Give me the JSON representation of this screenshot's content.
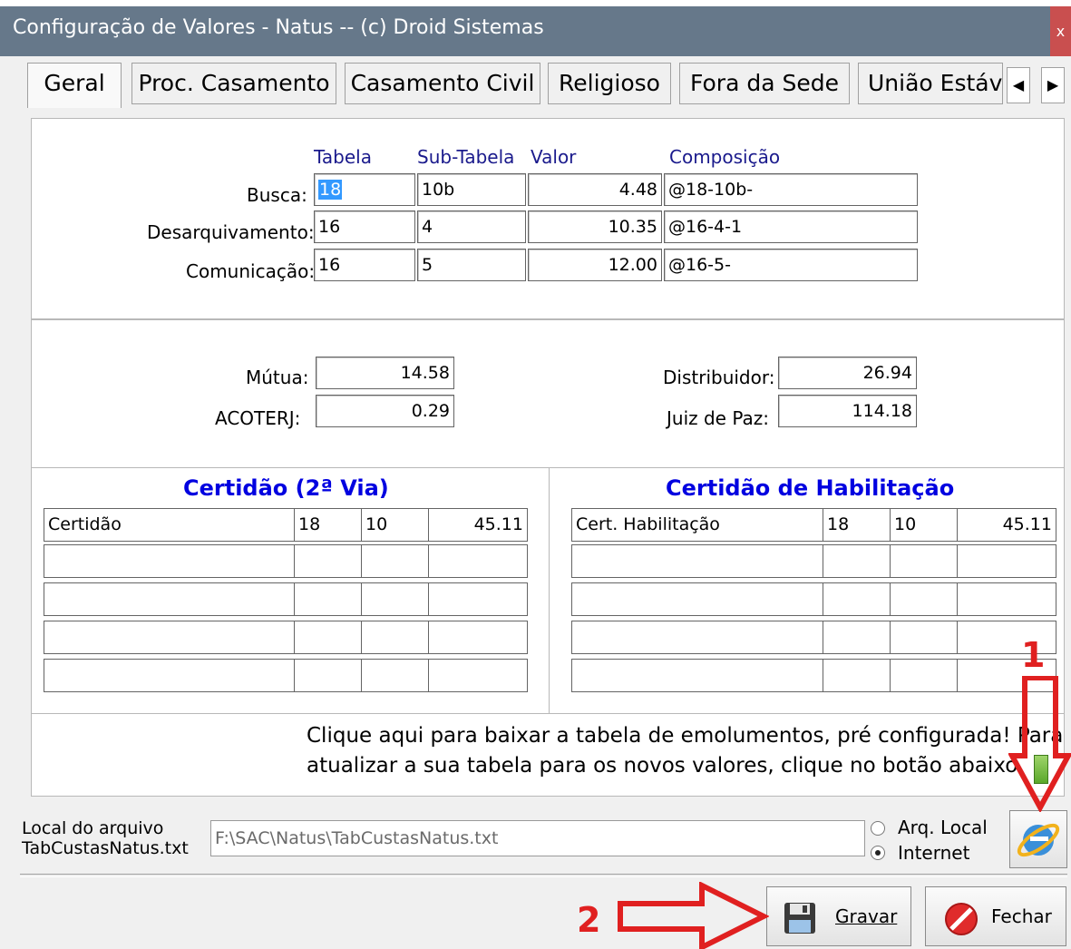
{
  "window": {
    "title": "Configuração de Valores - Natus  --  (c) Droid Sistemas",
    "close": "x"
  },
  "tabs": [
    "Geral",
    "Proc. Casamento",
    "Casamento Civil",
    "Religioso",
    "Fora da Sede",
    "União Estáv"
  ],
  "tab_arrows": {
    "left": "◀",
    "right": "▶"
  },
  "table_headers": {
    "tabela": "Tabela",
    "sub_tabela": "Sub-Tabela",
    "valor": "Valor",
    "composicao": "Composição"
  },
  "rows": [
    {
      "label": "Busca:",
      "tabela": "18",
      "sub": "10b",
      "valor": "4.48",
      "comp": "@18-10b-"
    },
    {
      "label": "Desarquivamento:",
      "tabela": "16",
      "sub": "4",
      "valor": "10.35",
      "comp": "@16-4-1"
    },
    {
      "label": "Comunicação:",
      "tabela": "16",
      "sub": "5",
      "valor": "12.00",
      "comp": "@16-5-"
    }
  ],
  "fees": {
    "mutua_label": "Mútua:",
    "mutua": "14.58",
    "acoterj_label": "ACOTERJ:",
    "acoterj": "0.29",
    "distribuidor_label": "Distribuidor:",
    "distribuidor": "26.94",
    "juiz_label": "Juiz de Paz:",
    "juiz": "114.18"
  },
  "cert2via": {
    "title": "Certidão (2ª Via)",
    "row": [
      "Certidão",
      "18",
      "10",
      "45.11"
    ]
  },
  "certHab": {
    "title": "Certidão de Habilitação",
    "row": [
      "Cert. Habilitação",
      "18",
      "10",
      "45.11"
    ]
  },
  "info": {
    "line1": "Clique aqui para baixar a tabela de emolumentos, pré configurada! Para",
    "line2": "atualizar a sua tabela para os novos valores, clique no botão abaixo."
  },
  "file": {
    "label1": "Local do arquivo",
    "label2": "TabCustasNatus.txt",
    "path": "F:\\SAC\\Natus\\TabCustasNatus.txt",
    "opt_local": "Arq. Local",
    "opt_internet": "Internet"
  },
  "buttons": {
    "gravar": "Gravar",
    "fechar": "Fechar"
  },
  "annotations": {
    "one": "1",
    "two": "2",
    "color": "#e02020"
  }
}
